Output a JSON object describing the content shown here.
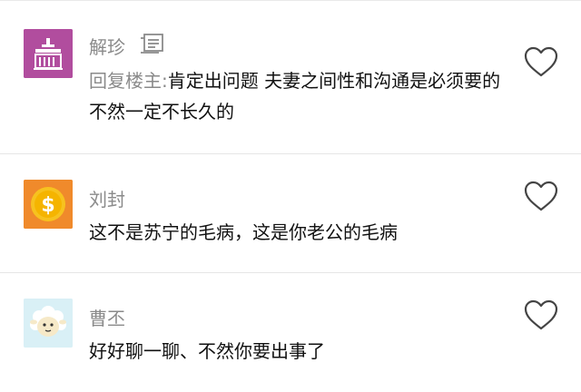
{
  "comments": [
    {
      "username": "解珍",
      "reply_prefix": "回复楼主:",
      "text": "肯定出问题 夫妻之间性和沟通是必须要的 不然一定不长久的",
      "avatar_icon": "building-icon",
      "avatar_color": "#b14d9e",
      "has_note_icon": true
    },
    {
      "username": "刘封",
      "text": "这不是苏宁的毛病，这是你老公的毛病",
      "avatar_icon": "dollar-coin-icon",
      "avatar_color": "#f08a2b"
    },
    {
      "username": "曹丕",
      "text": "好好聊一聊、不然你要出事了",
      "avatar_icon": "sheep-icon",
      "avatar_color": "#d9f0f6"
    }
  ]
}
